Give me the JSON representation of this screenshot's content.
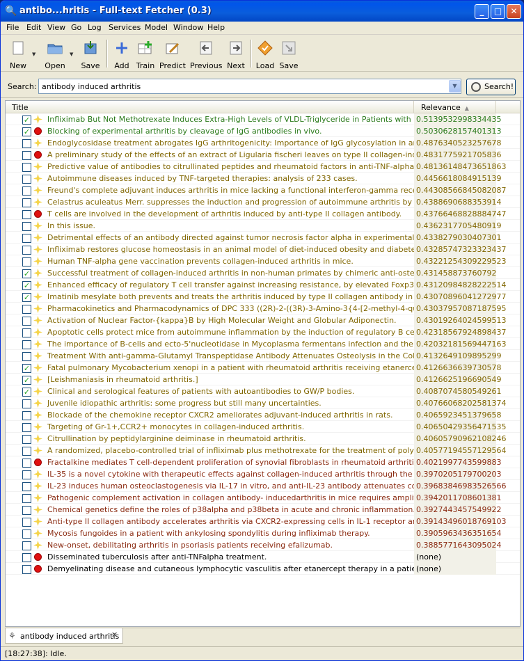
{
  "window": {
    "title": "antibo...hritis - Full-text Fetcher (0.3)"
  },
  "menu": [
    "File",
    "Edit",
    "View",
    "Go",
    "Log",
    "Services",
    "Model",
    "Window",
    "Help"
  ],
  "toolbar": {
    "new": "New",
    "open": "Open",
    "save": "Save",
    "add": "Add",
    "train": "Train",
    "predict": "Predict",
    "previous": "Previous",
    "next": "Next",
    "load": "Load",
    "save2": "Save"
  },
  "search": {
    "label": "Search:",
    "value": "antibody induced arthritis",
    "button": "Search!"
  },
  "table": {
    "headers": {
      "title": "Title",
      "relevance": "Relevance"
    },
    "rows": [
      {
        "checked": true,
        "marker": "star",
        "color": "green",
        "title": "Infliximab But Not Methotrexate Induces Extra-High Levels of VLDL-Triglyceride in Patients with Rheumatoid A",
        "relevance": "0.5139532998334435"
      },
      {
        "checked": true,
        "marker": "red",
        "color": "green",
        "title": "Blocking of experimental arthritis by cleavage of IgG antibodies in vivo.",
        "relevance": "0.5030628157401313"
      },
      {
        "checked": false,
        "marker": "star",
        "color": "olive",
        "title": "Endoglycosidase treatment abrogates IgG arthritogenicity: Importance of IgG glycosylation in arthritis.",
        "relevance": "0.487634052325767​8"
      },
      {
        "checked": false,
        "marker": "red",
        "color": "olive",
        "title": "A preliminary study of the effects of an extract of Ligularia fischeri leaves on type II collagen-induced arthriti",
        "relevance": "0.4831775921705836"
      },
      {
        "checked": false,
        "marker": "star",
        "color": "olive",
        "title": "Predictive value of antibodies to citrullinated peptides and rheumatoid factors in anti-TNF-alpha treated patier",
        "relevance": "0.4813614847365186​3"
      },
      {
        "checked": false,
        "marker": "star",
        "color": "olive",
        "title": "Autoimmune diseases induced by TNF-targeted therapies: analysis of 233 cases.",
        "relevance": "0.4456618084915139"
      },
      {
        "checked": false,
        "marker": "star",
        "color": "olive",
        "title": "Freund's complete adjuvant induces arthritis in mice lacking a functional interferon-gamma receptor by trigger",
        "relevance": "0.4430856684508208​7"
      },
      {
        "checked": false,
        "marker": "star",
        "color": "olive",
        "title": "Celastrus aculeatus Merr. suppresses the induction and progression of autoimmune arthritis by modulating imr",
        "relevance": "0.4388690688353914"
      },
      {
        "checked": false,
        "marker": "red",
        "color": "olive",
        "title": "T cells are involved in the development of arthritis induced by anti-type II collagen antibody.",
        "relevance": "0.4376646882888474​7"
      },
      {
        "checked": false,
        "marker": "star",
        "color": "olive",
        "title": "In this issue.",
        "relevance": "0.4362317705480919"
      },
      {
        "checked": false,
        "marker": "star",
        "color": "olive",
        "title": "Detrimental effects of an antibody directed against tumor necrosis factor alpha in experimental kidney irradiat",
        "relevance": "0.4338279030407301"
      },
      {
        "checked": false,
        "marker": "star",
        "color": "olive",
        "title": "Infliximab restores glucose homeostasis in an animal model of diet-induced obesity and diabetes.",
        "relevance": "0.4328574732332343​7"
      },
      {
        "checked": false,
        "marker": "star",
        "color": "olive",
        "title": "Human TNF-alpha gene vaccination prevents collagen-induced arthritis in mice.",
        "relevance": "0.4322125430922952​3"
      },
      {
        "checked": true,
        "marker": "star",
        "color": "olive",
        "title": "Successful treatment of collagen-induced arthritis in non-human primates by chimeric anti-osteopontin antiboc",
        "relevance": "0.431458873760792"
      },
      {
        "checked": true,
        "marker": "star",
        "color": "olive",
        "title": "Enhanced efficacy of regulatory T cell transfer against increasing resistance, by elevated Foxp3 expression ir",
        "relevance": "0.4312098482822251​4"
      },
      {
        "checked": true,
        "marker": "star",
        "color": "olive",
        "title": "Imatinib mesylate both prevents and treats the arthritis induced by type II collagen antibody in mice.",
        "relevance": "0.4307089604127297​7"
      },
      {
        "checked": false,
        "marker": "star",
        "color": "olive",
        "title": "Pharmacokinetics and Pharmacodynamics of DPC 333 ((2R)-2-((3R)-3-Amino-3{4-[2-methyl-4-quinolinyl) meth",
        "relevance": "0.4303795708718759​5"
      },
      {
        "checked": false,
        "marker": "star",
        "color": "olive",
        "title": "Activation of Nuclear Factor-{kappa}B by High Molecular Weight and Globular Adiponectin.",
        "relevance": "0.4301926402459951​3"
      },
      {
        "checked": false,
        "marker": "star",
        "color": "olive",
        "title": "Apoptotic cells protect mice from autoimmune inflammation by the induction of regulatory B cells.",
        "relevance": "0.4231856792489843​7"
      },
      {
        "checked": false,
        "marker": "star",
        "color": "olive",
        "title": "The importance of B-cells and ecto-5'nucleotidase in Mycoplasma fermentans infection and the relevance to rl",
        "relevance": "0.4203218156944716​3"
      },
      {
        "checked": false,
        "marker": "star",
        "color": "olive",
        "title": "Treatment With anti-gamma-Glutamyl Transpeptidase Antibody Attenuates Osteolysis in the Collagen-Induce",
        "relevance": "0.4132649109895299"
      },
      {
        "checked": true,
        "marker": "star",
        "color": "olive",
        "title": "Fatal pulmonary Mycobacterium xenopi in a patient with rheumatoid arthritis receiving etanercept.",
        "relevance": "0.4126636639730578"
      },
      {
        "checked": true,
        "marker": "star",
        "color": "olive",
        "title": "[Leishmaniasis in rheumatoid arthritis.]",
        "relevance": "0.4126625196690549"
      },
      {
        "checked": true,
        "marker": "star",
        "color": "olive",
        "title": "Clinical and serological features of patients with autoantibodies to GW/P bodies.",
        "relevance": "0.4087074580549261"
      },
      {
        "checked": false,
        "marker": "star",
        "color": "olive",
        "title": "Juvenile idiopathic arthritis: some progress but still many uncertainties.",
        "relevance": "0.4076606820258137​4"
      },
      {
        "checked": false,
        "marker": "star",
        "color": "olive",
        "title": "Blockade of the chemokine receptor CXCR2 ameliorates adjuvant-induced arthritis in rats.",
        "relevance": "0.4065923451379658"
      },
      {
        "checked": false,
        "marker": "star",
        "color": "olive",
        "title": "Targeting of Gr-1+,CCR2+ monocytes in collagen-induced arthritis.",
        "relevance": "0.4065042935647153​5"
      },
      {
        "checked": false,
        "marker": "star",
        "color": "olive",
        "title": "Citrullination by peptidylarginine deiminase in rheumatoid arthritis.",
        "relevance": "0.4060579096210824​6"
      },
      {
        "checked": false,
        "marker": "star",
        "color": "olive",
        "title": "A randomized, placebo-controlled trial of infliximab plus methotrexate for the treatment of polyarticular-cours",
        "relevance": "0.4057719455712956​4"
      },
      {
        "checked": false,
        "marker": "red",
        "color": "brown",
        "title": "Fractalkine mediates T cell-dependent proliferation of synovial fibroblasts in rheumatoid arthritis.",
        "relevance": "0.4021997743599883"
      },
      {
        "checked": false,
        "marker": "star",
        "color": "brown",
        "title": "IL-35 is a novel cytokine with therapeutic effects against collagen-induced arthritis through the expansion of",
        "relevance": "0.3970205179700203"
      },
      {
        "checked": false,
        "marker": "star",
        "color": "brown",
        "title": "IL-23 induces human osteoclastogenesis via IL-17 in vitro, and anti-IL-23 antibody attenuates collagen-induce",
        "relevance": "0.3968384698352656​6"
      },
      {
        "checked": false,
        "marker": "star",
        "color": "brown",
        "title": "Pathogenic complement activation in collagen antibody- inducedarthritis in mice requires amplification by the a",
        "relevance": "0.3942011708601381"
      },
      {
        "checked": false,
        "marker": "star",
        "color": "brown",
        "title": "Chemical genetics define the roles of p38alpha and p38beta in acute and chronic inflammation.",
        "relevance": "0.3927443457549922"
      },
      {
        "checked": false,
        "marker": "star",
        "color": "brown",
        "title": "Anti-type II collagen antibody accelerates arthritis via CXCR2-expressing cells in IL-1 receptor antagonist-def",
        "relevance": "0.3914349601876910​3"
      },
      {
        "checked": false,
        "marker": "star",
        "color": "brown",
        "title": "Mycosis fungoides in a patient with ankylosing spondylitis during infliximab therapy.",
        "relevance": "0.3905963436351654"
      },
      {
        "checked": false,
        "marker": "star",
        "color": "brown",
        "title": "New-onset, debilitating arthritis in psoriasis patients receiving efalizumab.",
        "relevance": "0.3885771643095024"
      },
      {
        "checked": false,
        "marker": "red",
        "color": "black",
        "title": "Disseminated tuberculosis after anti-TNFalpha treatment.",
        "relevance": "(none)"
      },
      {
        "checked": false,
        "marker": "red",
        "color": "black",
        "title": "Demyelinating disease and cutaneous lymphocytic vasculitis after etanercept therapy in a patient with rheuma",
        "relevance": "(none)"
      }
    ]
  },
  "tab": {
    "label": "antibody induced arthritis"
  },
  "status": {
    "text": "[18:27:38]: Idle."
  }
}
